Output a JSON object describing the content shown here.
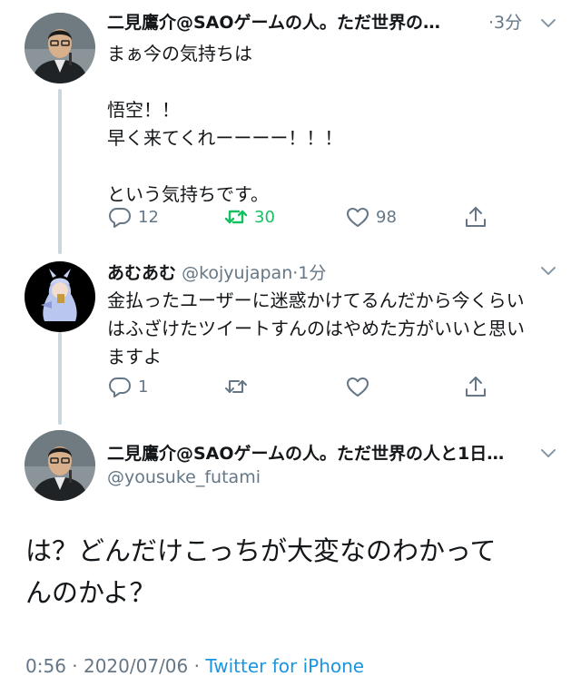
{
  "tweet1": {
    "name": "二見鷹介@SAOゲームの人。ただ世界の…",
    "time": "3分",
    "text": "まぁ今の気持ちは\n\n悟空！！\n早く来てくれーーーー！！！\n\nという気持ちです。",
    "reply_count": "12",
    "retweet_count": "30",
    "like_count": "98"
  },
  "tweet2": {
    "name": "あむあむ",
    "handle": "@kojyujapan",
    "time": "1分",
    "text": "金払ったユーザーに迷惑かけてるんだから今くらい\nはふざけたツイートすんのはやめた方がいいと思い\nますよ",
    "reply_count": "1"
  },
  "main_tweet": {
    "name": "二見鷹介@SAOゲームの人。ただ世界の人と1日…",
    "handle": "@yousuke_futami",
    "text": "は？どんだけこっちが大変なのわかって\nんのかよ？",
    "timestamp": "0:56 · 2020/07/06 · ",
    "source": "Twitter for iPhone"
  },
  "icons": {
    "reply": "reply-icon",
    "retweet": "retweet-icon",
    "like": "heart-icon",
    "share": "share-icon",
    "more": "chevron-down-icon"
  },
  "colors": {
    "text": "#14171a",
    "secondary": "#657786",
    "retweet_active": "#17bf63",
    "link": "#1b95e0",
    "thread_line": "#ccd6dd"
  }
}
